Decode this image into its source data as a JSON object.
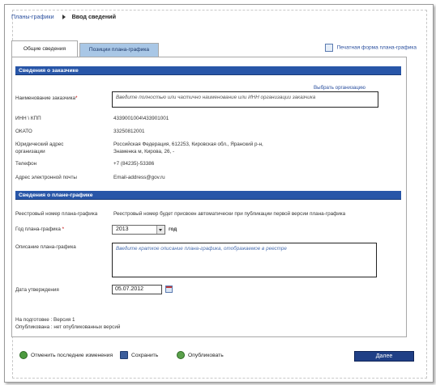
{
  "breadcrumb": {
    "parent": "Планы-графики",
    "current": "Ввод сведений"
  },
  "print_link": "Печатная форма плана-графика",
  "tabs": [
    {
      "label": "Общие сведения"
    },
    {
      "label": "Позиции плана-графика"
    }
  ],
  "customer": {
    "section_title": "Сведения о заказчике",
    "choose_org_link": "Выбрать организацию",
    "name_label": "Наименование заказчика",
    "name_placeholder": "Введите полностью или частично наименование или ИНН организации заказчика",
    "inn_kpp_label": "ИНН \\ КПП",
    "inn_kpp_value": "4339001004\\433901001",
    "okato_label": "ОКАТО",
    "okato_value": "33250812001",
    "address_label": "Юридический адрес организации",
    "address_value": "Российская Федерация, 612253, Кировская обл., Яранский р-н, Знаменка м, Кирова, 26, -",
    "phone_label": "Телефон",
    "phone_value": "+7 (84235)-53386",
    "email_label": "Адрес электронной почты",
    "email_value": "Email-address@gov.ru"
  },
  "plan": {
    "section_title": "Сведения о плане-графике",
    "reg_label": "Реестровый номер плана-графика",
    "reg_value": "Реестровый номер будет присвоен автоматически при публикации первой версии плана-графика",
    "year_label": "Год плана-графика",
    "year_value": "2013",
    "year_suffix": "год",
    "desc_label": "Описание плана-графика",
    "desc_placeholder": "Введите краткое описание плана-графика, отображаемое в реестре",
    "date_label": "Дата утверждения",
    "date_value": "05.07.2012"
  },
  "status": {
    "prep": "На подготовке : Версия 1",
    "pub": "Опубликована : нет опубликованных версий"
  },
  "footer": {
    "cancel": "Отменить последние изменения",
    "save": "Сохранить",
    "publish": "Опубликовать",
    "next": "Далее"
  }
}
